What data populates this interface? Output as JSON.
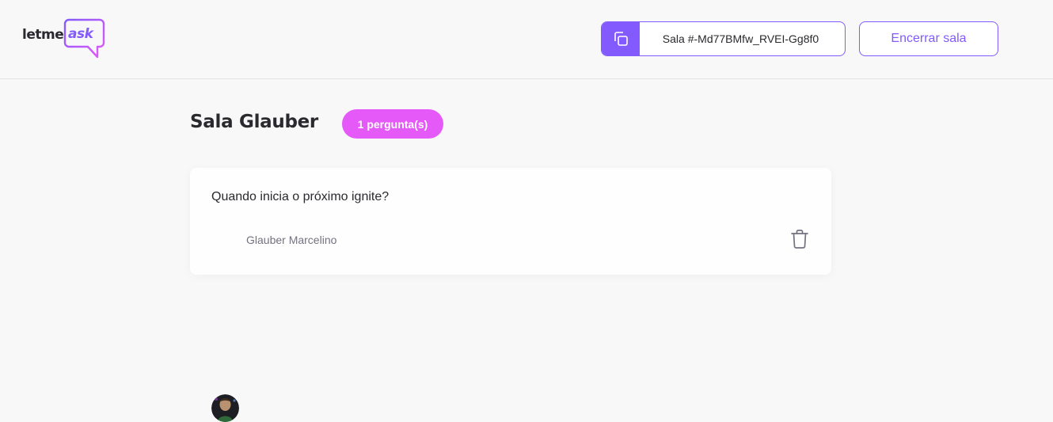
{
  "header": {
    "logo_letme": "letme",
    "logo_ask": "ask",
    "room_code": "Sala #-Md77BMfw_RVEI-Gg8f0",
    "end_room_label": "Encerrar sala"
  },
  "room": {
    "title": "Sala Glauber",
    "question_count": "1 pergunta(s)"
  },
  "questions": [
    {
      "content": "Quando inicia o próximo ignite?",
      "author": "Glauber Marcelino"
    }
  ],
  "colors": {
    "brand_purple": "#835afd",
    "badge_pink": "#e559f9",
    "background": "#f8f8f8",
    "text_dark": "#29292e",
    "text_muted": "#737380"
  },
  "icons": {
    "copy": "copy-icon",
    "delete": "trash-icon"
  }
}
